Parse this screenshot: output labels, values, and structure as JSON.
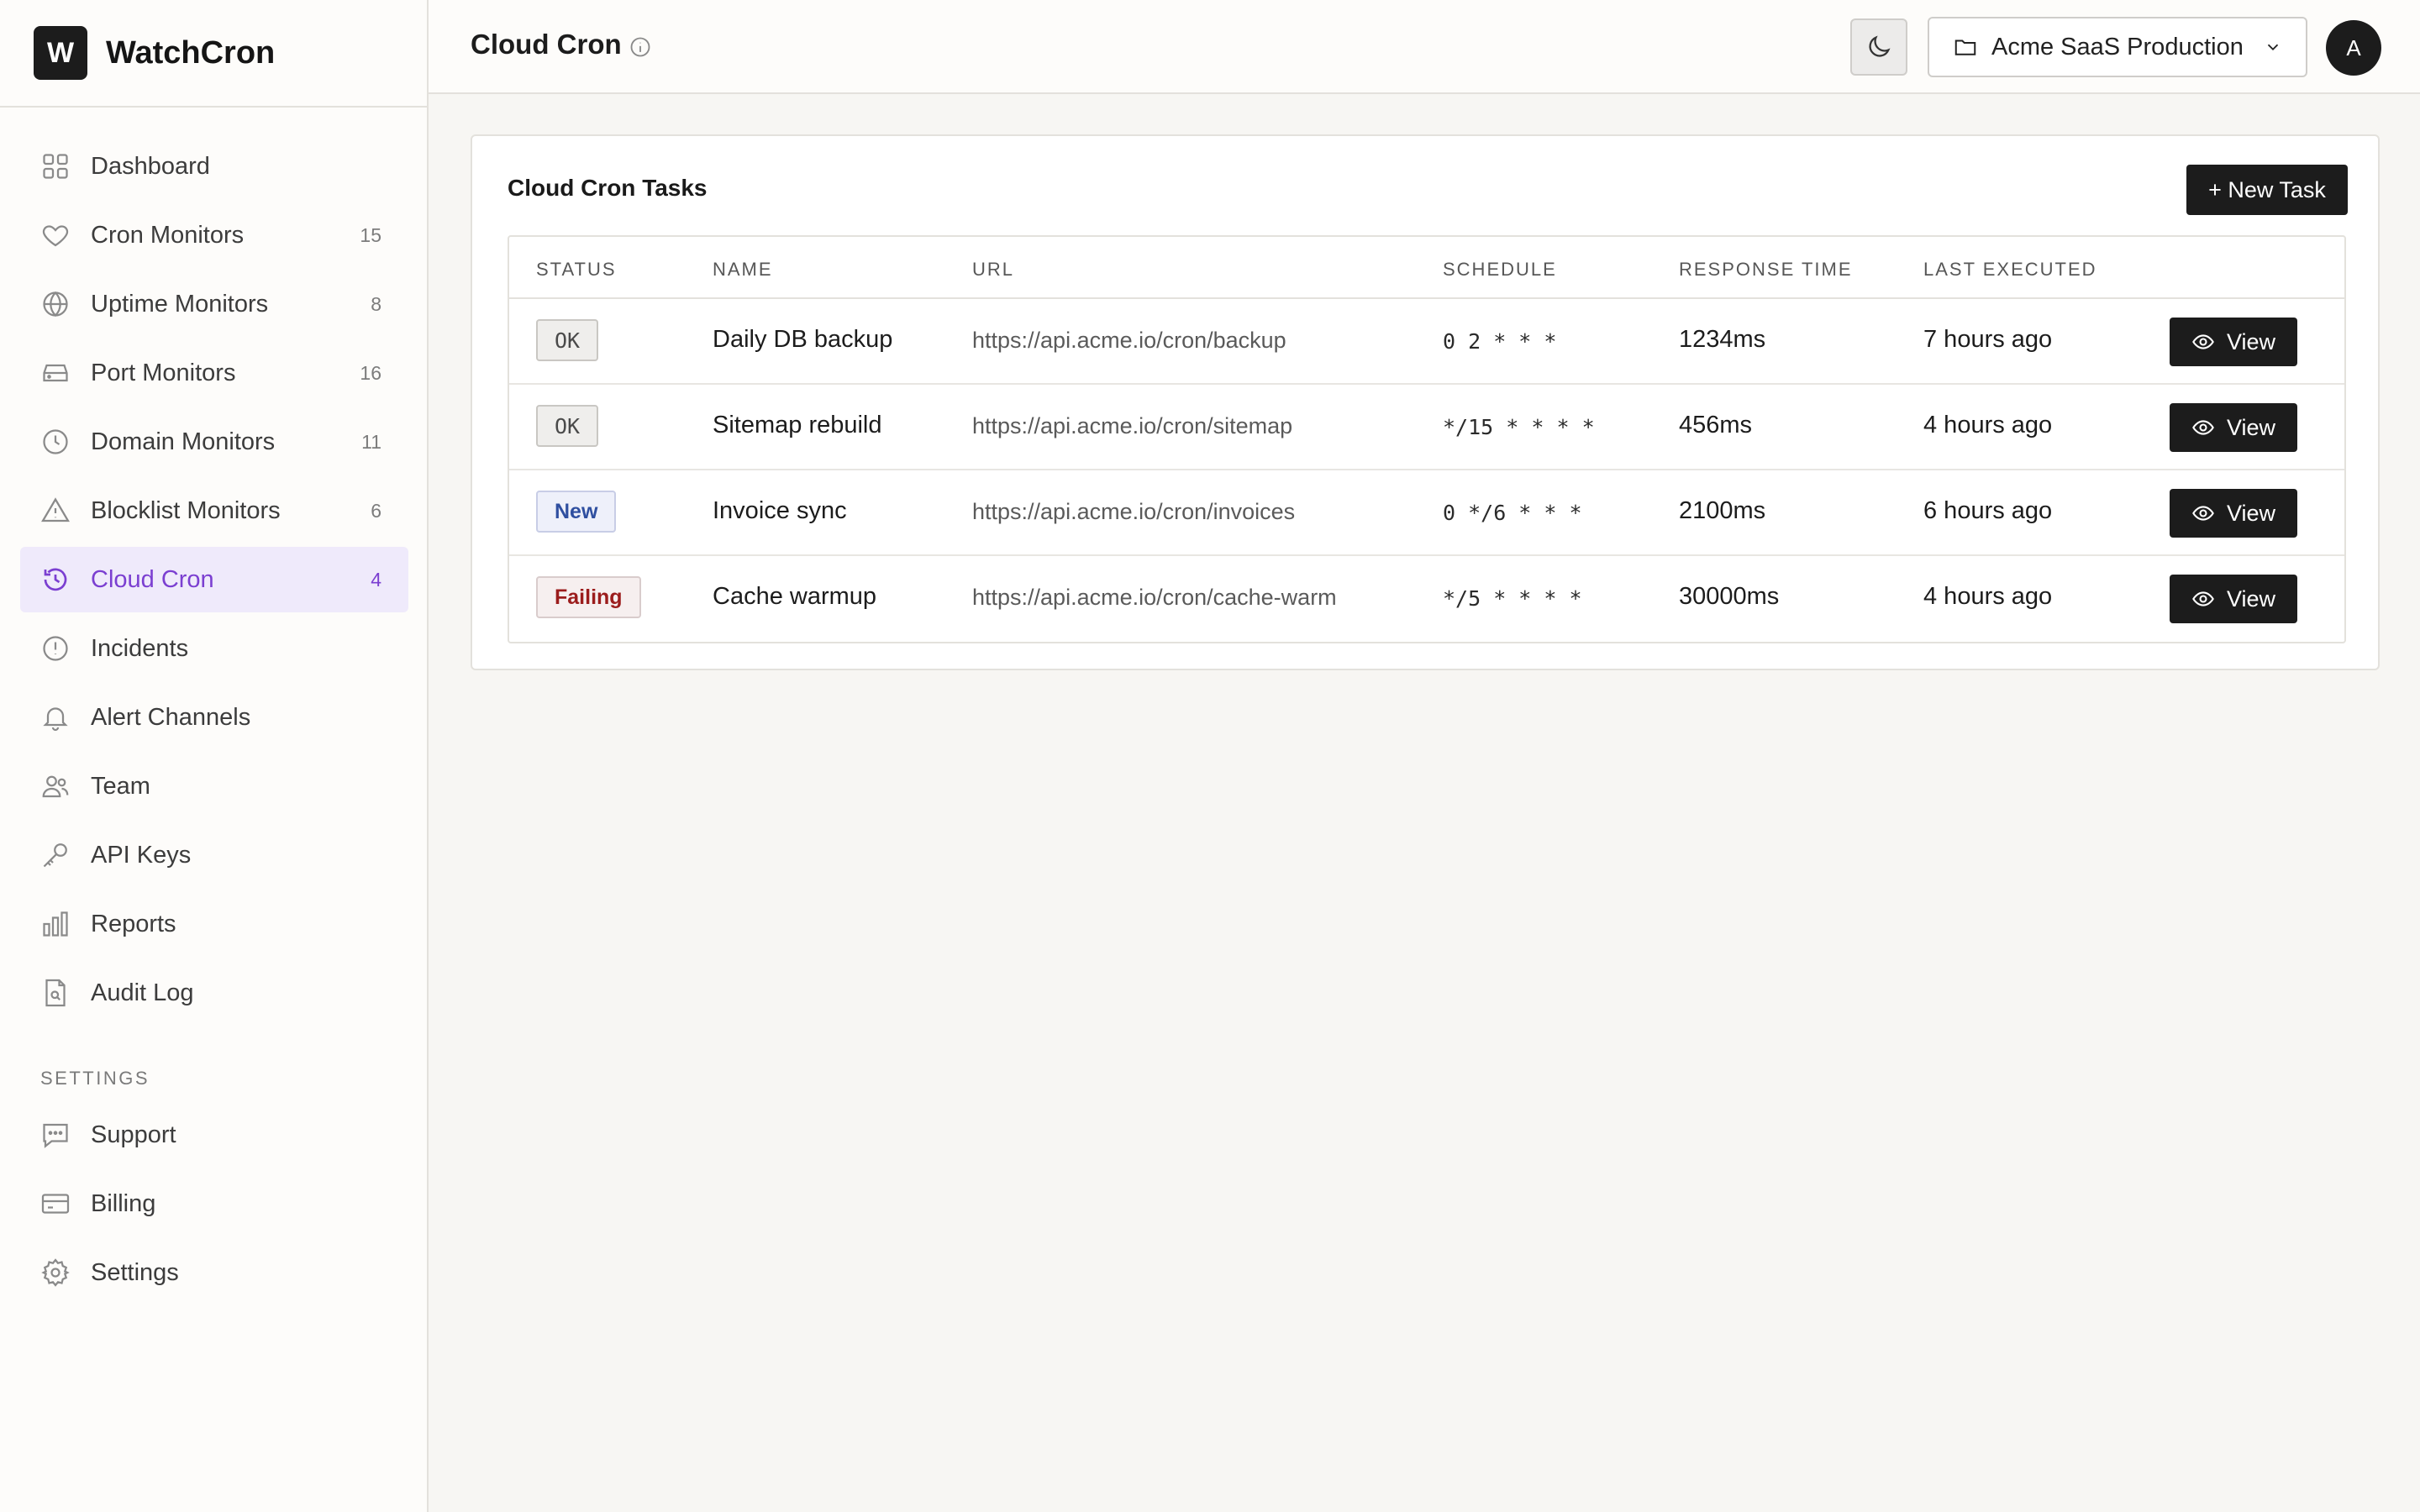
{
  "brand": {
    "logo_letter": "W",
    "name": "WatchCron"
  },
  "sidebar": {
    "items": [
      {
        "label": "Dashboard",
        "count": "",
        "icon": "grid-icon"
      },
      {
        "label": "Cron Monitors",
        "count": "15",
        "icon": "heart-icon"
      },
      {
        "label": "Uptime Monitors",
        "count": "8",
        "icon": "globe-icon"
      },
      {
        "label": "Port Monitors",
        "count": "16",
        "icon": "server-icon"
      },
      {
        "label": "Domain Monitors",
        "count": "11",
        "icon": "clock-icon"
      },
      {
        "label": "Blocklist Monitors",
        "count": "6",
        "icon": "warning-icon"
      },
      {
        "label": "Cloud Cron",
        "count": "4",
        "icon": "cloud-cron-icon",
        "active": true
      },
      {
        "label": "Incidents",
        "count": "",
        "icon": "alert-circle-icon"
      },
      {
        "label": "Alert Channels",
        "count": "",
        "icon": "bell-icon"
      },
      {
        "label": "Team",
        "count": "",
        "icon": "users-icon"
      },
      {
        "label": "API Keys",
        "count": "",
        "icon": "key-icon"
      },
      {
        "label": "Reports",
        "count": "",
        "icon": "bar-chart-icon"
      },
      {
        "label": "Audit Log",
        "count": "",
        "icon": "file-search-icon"
      }
    ],
    "settings_label": "SETTINGS",
    "settings_items": [
      {
        "label": "Support",
        "icon": "chat-icon"
      },
      {
        "label": "Billing",
        "icon": "credit-card-icon"
      },
      {
        "label": "Settings",
        "icon": "gear-icon"
      }
    ]
  },
  "header": {
    "title": "Cloud Cron",
    "project": "Acme SaaS Production",
    "avatar_letter": "A"
  },
  "card": {
    "title": "Cloud Cron Tasks",
    "new_task_label": "+ New Task"
  },
  "table": {
    "columns": [
      "STATUS",
      "NAME",
      "URL",
      "SCHEDULE",
      "RESPONSE TIME",
      "LAST EXECUTED"
    ],
    "rows": [
      {
        "status": "OK",
        "status_type": "ok",
        "name": "Daily DB backup",
        "url": "https://api.acme.io/cron/backup",
        "schedule": "0 2 * * *",
        "response_time": "1234ms",
        "last_executed": "7 hours ago",
        "action": "View"
      },
      {
        "status": "OK",
        "status_type": "ok",
        "name": "Sitemap rebuild",
        "url": "https://api.acme.io/cron/sitemap",
        "schedule": "*/15 * * * *",
        "response_time": "456ms",
        "last_executed": "4 hours ago",
        "action": "View"
      },
      {
        "status": "New",
        "status_type": "new",
        "name": "Invoice sync",
        "url": "https://api.acme.io/cron/invoices",
        "schedule": "0 */6 * * *",
        "response_time": "2100ms",
        "last_executed": "6 hours ago",
        "action": "View"
      },
      {
        "status": "Failing",
        "status_type": "failing",
        "name": "Cache warmup",
        "url": "https://api.acme.io/cron/cache-warm",
        "schedule": "*/5 * * * *",
        "response_time": "30000ms",
        "last_executed": "4 hours ago",
        "action": "View"
      }
    ]
  },
  "colors": {
    "accent": "#7b3fd1",
    "active_bg": "#efeafb",
    "dark": "#1c1c1c",
    "failing": "#9b1c1c",
    "new": "#2f4fa0"
  }
}
